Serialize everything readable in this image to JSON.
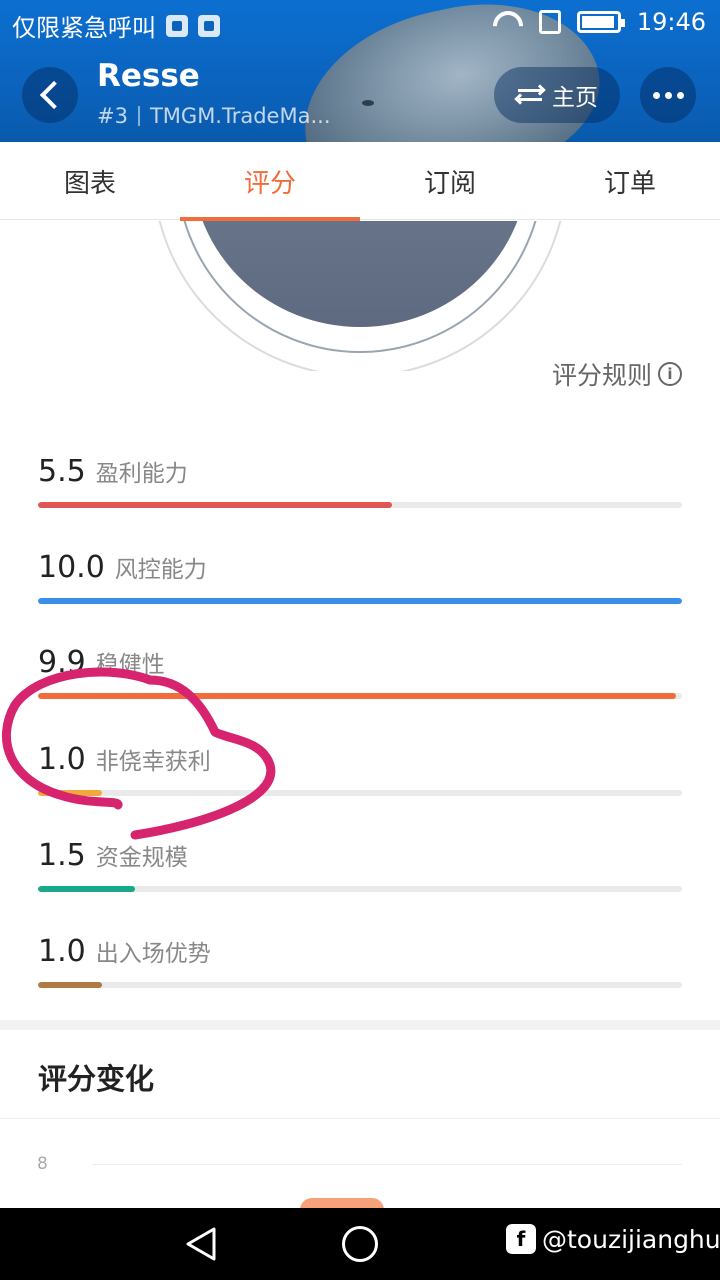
{
  "status_bar": {
    "carrier_text": "仅限紧急呼叫",
    "time": "19:46"
  },
  "header": {
    "title": "Resse",
    "rank": "#3",
    "broker": "TMGM.TradeMa...",
    "home_label": "主页"
  },
  "tabs": [
    {
      "label": "图表",
      "active": false
    },
    {
      "label": "评分",
      "active": true
    },
    {
      "label": "订阅",
      "active": false
    },
    {
      "label": "订单",
      "active": false
    }
  ],
  "rules_link": "评分规则",
  "metrics": [
    {
      "value": "5.5",
      "label": "盈利能力",
      "fraction": 0.55,
      "color": "#e05555"
    },
    {
      "value": "10.0",
      "label": "风控能力",
      "fraction": 1.0,
      "color": "#3a8ee6"
    },
    {
      "value": "9.9",
      "label": "稳健性",
      "fraction": 0.99,
      "color": "#f26b3a"
    },
    {
      "value": "1.0",
      "label": "非侥幸获利",
      "fraction": 0.1,
      "color": "#f0a93b"
    },
    {
      "value": "1.5",
      "label": "资金规模",
      "fraction": 0.15,
      "color": "#1aa88a"
    },
    {
      "value": "1.0",
      "label": "出入场优势",
      "fraction": 0.1,
      "color": "#b07a45"
    }
  ],
  "section": {
    "title": "评分变化",
    "y_tick": "8"
  },
  "watermark": {
    "logo": "f",
    "handle": "@touzijianghu"
  },
  "colors": {
    "accent": "#f26b3a",
    "header_blue": "#0b63bd",
    "annotation": "#d6246e"
  },
  "icons": [
    "back-chevron-icon",
    "swap-icon",
    "more-dots-icon",
    "info-icon",
    "wifi-icon",
    "battery-icon",
    "nav-back-icon",
    "nav-home-icon"
  ]
}
